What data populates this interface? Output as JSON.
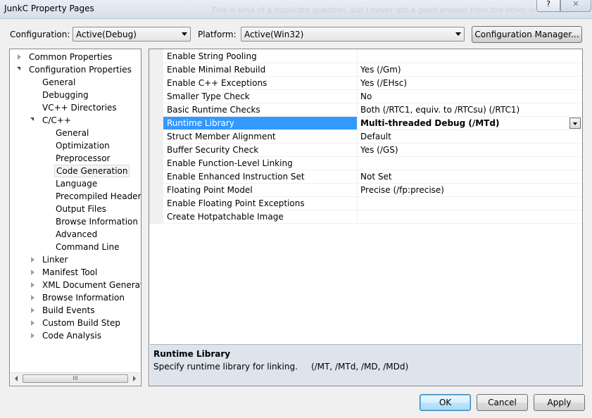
{
  "window": {
    "title": "JunkC Property Pages",
    "background_text": "This is kind of a duplicate question, but I never got a good answer from the other ones - I've",
    "help_label": "?",
    "close_label": "✕"
  },
  "config_bar": {
    "configuration_label": "Configuration:",
    "configuration_value": "Active(Debug)",
    "platform_label": "Platform:",
    "platform_value": "Active(Win32)",
    "manager_button": "Configuration Manager..."
  },
  "tree": [
    {
      "label": "Common Properties",
      "expander": "collapsed"
    },
    {
      "label": "Configuration Properties",
      "expander": "expanded"
    },
    {
      "label": "General",
      "expander": "none"
    },
    {
      "label": "Debugging",
      "expander": "none"
    },
    {
      "label": "VC++ Directories",
      "expander": "none"
    },
    {
      "label": "C/C++",
      "expander": "expanded"
    },
    {
      "label": "General",
      "expander": "none"
    },
    {
      "label": "Optimization",
      "expander": "none"
    },
    {
      "label": "Preprocessor",
      "expander": "none"
    },
    {
      "label": "Code Generation",
      "expander": "none",
      "selected": true
    },
    {
      "label": "Language",
      "expander": "none"
    },
    {
      "label": "Precompiled Headers",
      "expander": "none"
    },
    {
      "label": "Output Files",
      "expander": "none"
    },
    {
      "label": "Browse Information",
      "expander": "none"
    },
    {
      "label": "Advanced",
      "expander": "none"
    },
    {
      "label": "Command Line",
      "expander": "none"
    },
    {
      "label": "Linker",
      "expander": "collapsed"
    },
    {
      "label": "Manifest Tool",
      "expander": "collapsed"
    },
    {
      "label": "XML Document Generator",
      "expander": "collapsed"
    },
    {
      "label": "Browse Information",
      "expander": "collapsed"
    },
    {
      "label": "Build Events",
      "expander": "collapsed"
    },
    {
      "label": "Custom Build Step",
      "expander": "collapsed"
    },
    {
      "label": "Code Analysis",
      "expander": "collapsed"
    }
  ],
  "tree_scroll_grip": "III",
  "properties": [
    {
      "name": "Enable String Pooling",
      "value": ""
    },
    {
      "name": "Enable Minimal Rebuild",
      "value": "Yes (/Gm)"
    },
    {
      "name": "Enable C++ Exceptions",
      "value": "Yes (/EHsc)"
    },
    {
      "name": "Smaller Type Check",
      "value": "No"
    },
    {
      "name": "Basic Runtime Checks",
      "value": "Both (/RTC1, equiv. to /RTCsu) (/RTC1)"
    },
    {
      "name": "Runtime Library",
      "value": "Multi-threaded Debug (/MTd)",
      "selected": true
    },
    {
      "name": "Struct Member Alignment",
      "value": "Default"
    },
    {
      "name": "Buffer Security Check",
      "value": "Yes (/GS)"
    },
    {
      "name": "Enable Function-Level Linking",
      "value": ""
    },
    {
      "name": "Enable Enhanced Instruction Set",
      "value": "Not Set"
    },
    {
      "name": "Floating Point Model",
      "value": "Precise (/fp:precise)"
    },
    {
      "name": "Enable Floating Point Exceptions",
      "value": ""
    },
    {
      "name": "Create Hotpatchable Image",
      "value": ""
    }
  ],
  "description": {
    "title": "Runtime Library",
    "text": "Specify runtime library for linking.     (/MT, /MTd, /MD, /MDd)"
  },
  "buttons": {
    "ok": "OK",
    "cancel": "Cancel",
    "apply": "Apply"
  },
  "colors": {
    "selection": "#3399ff",
    "dialog_bg": "#f0f0f0",
    "description_bg": "#dde4ec"
  }
}
